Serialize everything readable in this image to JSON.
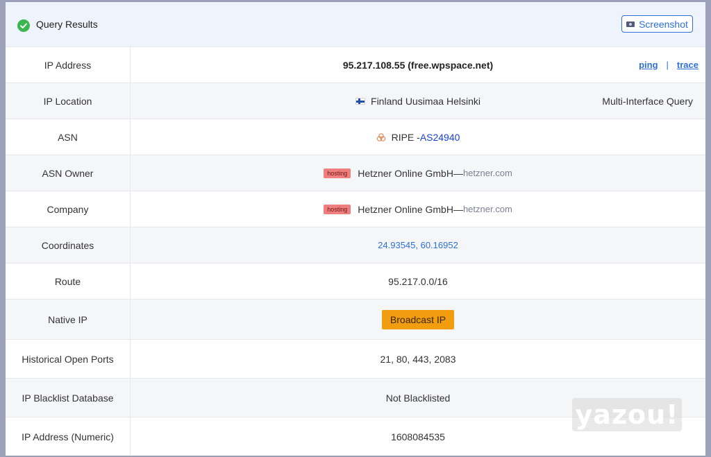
{
  "header": {
    "title": "Query Results",
    "screenshot_label": "Screenshot"
  },
  "rows": {
    "ip": {
      "label": "IP Address",
      "value": "95.217.108.55 (free.wpspace.net)",
      "ping": "ping",
      "separator": "|",
      "trace": "trace"
    },
    "location": {
      "label": "IP Location",
      "value": "Finland Uusimaa Helsinki",
      "multi": "Multi-Interface Query"
    },
    "asn": {
      "label": "ASN",
      "registry": "RIPE - ",
      "asn": "AS24940"
    },
    "asn_owner": {
      "label": "ASN Owner",
      "badge": "hosting",
      "name": "Hetzner Online GmbH",
      "dash": "—",
      "domain": "hetzner.com"
    },
    "company": {
      "label": "Company",
      "badge": "hosting",
      "name": "Hetzner Online GmbH",
      "dash": "—",
      "domain": "hetzner.com"
    },
    "coordinates": {
      "label": "Coordinates",
      "value": "24.93545, 60.16952"
    },
    "route": {
      "label": "Route",
      "value": "95.217.0.0/16"
    },
    "native": {
      "label": "Native IP",
      "value": "Broadcast IP"
    },
    "ports": {
      "label": "Historical Open Ports",
      "value": "21, 80, 443, 2083"
    },
    "blacklist": {
      "label": "IP Blacklist Database",
      "value": "Not Blacklisted"
    },
    "numeric": {
      "label": "IP Address (Numeric)",
      "value": "1608084535"
    }
  },
  "watermark": "yazou!",
  "colors": {
    "accent": "#2f6fd8",
    "success": "#3bb650",
    "hosting_badge": "#ef7f7f",
    "broadcast": "#f29c0f"
  },
  "icons": [
    "check-circle-icon",
    "camera-icon",
    "finland-flag-icon",
    "ripe-icon"
  ]
}
